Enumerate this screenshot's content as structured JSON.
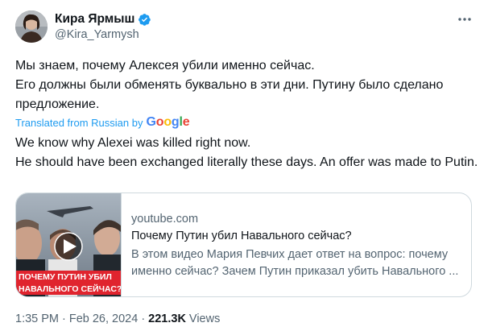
{
  "author": {
    "display_name": "Кира Ярмыш",
    "handle": "@Kira_Yarmysh"
  },
  "tweet": {
    "original_lines": [
      "Мы знаем, почему Алексея убили именно сейчас.",
      "Его должны были обменять буквально в эти дни. Путину было сделано предложение."
    ],
    "translated_from": "Translated from Russian by",
    "translator": "Google",
    "translation_lines": [
      "We know why Alexei was killed right now.",
      "He should have been exchanged literally these days. An offer was made to Putin."
    ]
  },
  "card": {
    "domain": "youtube.com",
    "title": "Почему Путин убил Навального сейчас?",
    "description": "В этом видео Мария Певчих дает ответ на вопрос: почему именно сейчас? Зачем Путин приказал убить Навального ...",
    "thumbnail_caption_line1": "ПОЧЕМУ ПУТИН УБИЛ",
    "thumbnail_caption_line2": "НАВАЛЬНОГО СЕЙЧАС?"
  },
  "meta": {
    "time": "1:35 PM",
    "separator": "·",
    "date": "Feb 26, 2024",
    "views_count": "221.3K",
    "views_label": "Views"
  },
  "icons": {
    "verified": "verified-badge-icon",
    "more": "more-options-icon",
    "play": "play-icon"
  },
  "colors": {
    "link_blue": "#1d9bf0",
    "text_primary": "#0f1419",
    "text_secondary": "#536471",
    "border": "#cfd9de",
    "thumbnail_caption_red": "#e0242e"
  }
}
